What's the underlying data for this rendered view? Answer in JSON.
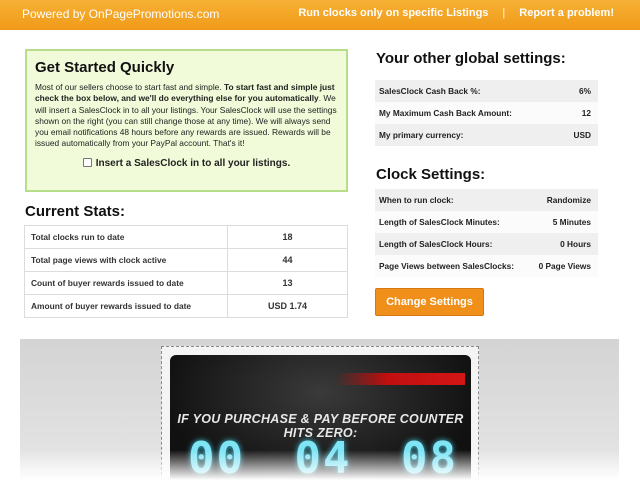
{
  "header": {
    "brand": "Powered by OnPagePromotions.com",
    "link_run_clocks": "Run clocks only on specific Listings",
    "separator": "|",
    "link_report": "Report a problem!"
  },
  "get_started": {
    "title": "Get Started Quickly",
    "text_part1": "Most of our sellers choose to start fast and simple. ",
    "text_bold": "To start fast and simple just check the box below, and we'll do everything else for you automatically",
    "text_part2": ". We will insert a SalesClock in to all your listings. Your SalesClock will use the settings shown on the right (you can still change those at any time). We will always send you email notifications 48 hours before any rewards are issued. Rewards will be issued automatically from your PayPal account. That's it!",
    "checkbox_label": "Insert a SalesClock in to all your listings.",
    "checkbox_checked": false
  },
  "current_stats": {
    "title": "Current Stats:",
    "rows": [
      {
        "label": "Total clocks run to date",
        "value": "18"
      },
      {
        "label": "Total page views with clock active",
        "value": "44"
      },
      {
        "label": "Count of buyer rewards issued to date",
        "value": "13"
      },
      {
        "label": "Amount of buyer rewards issued to date",
        "value": "USD 1.74"
      }
    ]
  },
  "global_settings": {
    "title": "Your other global settings:",
    "rows": [
      {
        "label": "SalesClock Cash Back %:",
        "value": "6%"
      },
      {
        "label": "My Maximum Cash Back Amount:",
        "value": "12"
      },
      {
        "label": "My primary currency:",
        "value": "USD"
      }
    ]
  },
  "clock_settings": {
    "title": "Clock Settings:",
    "rows": [
      {
        "label": "When to run clock:",
        "value": "Randomize"
      },
      {
        "label": "Length of SalesClock Minutes:",
        "value": "5 Minutes"
      },
      {
        "label": "Length of SalesClock Hours:",
        "value": "0 Hours"
      },
      {
        "label": "Page Views between SalesClocks:",
        "value": "0 Page Views"
      }
    ],
    "button_label": "Change Settings"
  },
  "preview": {
    "headline": "IF YOU PURCHASE & PAY BEFORE COUNTER HITS ZERO:",
    "digits": [
      "00",
      "04",
      "08"
    ]
  }
}
